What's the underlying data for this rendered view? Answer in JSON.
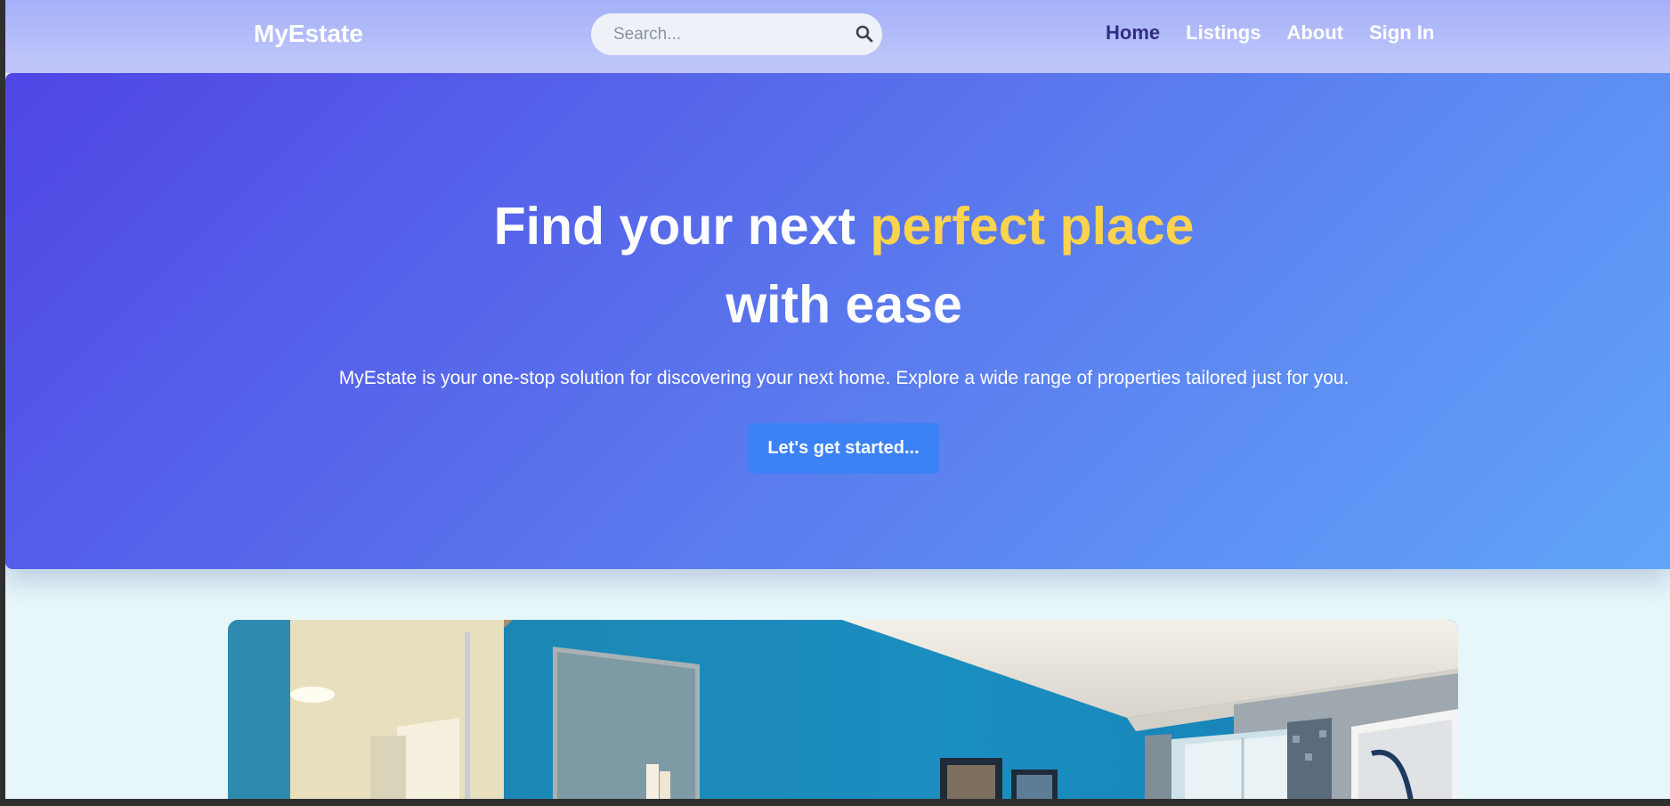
{
  "header": {
    "logo": "MyEstate",
    "search": {
      "placeholder": "Search...",
      "value": ""
    },
    "nav": [
      {
        "label": "Home",
        "active": true
      },
      {
        "label": "Listings",
        "active": false
      },
      {
        "label": "About",
        "active": false
      },
      {
        "label": "Sign In",
        "active": false
      }
    ]
  },
  "hero": {
    "title_part1": "Find your next ",
    "title_highlight": "perfect place",
    "title_part2": "with ease",
    "subtitle": "MyEstate is your one-stop solution for discovering your next home. Explore a wide range of properties tailored just for you.",
    "cta_label": "Let's get started...",
    "highlight_color": "#fcd34d"
  },
  "colors": {
    "accent": "#3b82f6",
    "active_nav": "#312e81"
  },
  "icons": {
    "search": "search-icon"
  },
  "photo": {
    "subject": "blue-painted-room-with-mirrors-and-window"
  }
}
